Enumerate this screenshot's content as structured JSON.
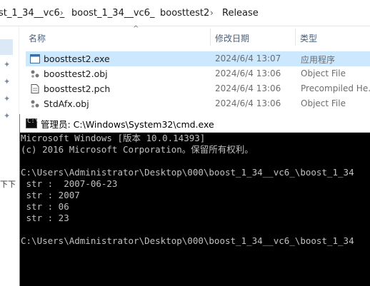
{
  "explorer": {
    "breadcrumb": [
      "st_1_34__vc6_",
      "boost_1_34__vc6_",
      "boosttest2",
      "Release"
    ],
    "columns": {
      "name": "名称",
      "date": "修改日期",
      "type": "类型"
    },
    "files": [
      {
        "name": "boosttest2.exe",
        "date": "2024/6/4 13:07",
        "type": "应用程序",
        "icon": "exe-icon",
        "selected": true
      },
      {
        "name": "boosttest2.obj",
        "date": "2024/6/4 13:06",
        "type": "Object File",
        "icon": "obj-icon"
      },
      {
        "name": "boosttest2.pch",
        "date": "2024/6/4 13:06",
        "type": "Precompiled He...",
        "icon": "pch-icon"
      },
      {
        "name": "StdAfx.obj",
        "date": "2024/6/4 13:06",
        "type": "Object File",
        "icon": "obj-icon"
      }
    ],
    "left_edge_text": "下下"
  },
  "cmd": {
    "title": "管理员: C:\\Windows\\System32\\cmd.exe",
    "lines": [
      "Microsoft Windows [版本 10.0.14393]",
      "(c) 2016 Microsoft Corporation。保留所有权利。",
      "",
      "C:\\Users\\Administrator\\Desktop\\000\\boost_1_34__vc6_\\boost_1_34",
      " str :  2007-06-23",
      " str : 2007",
      " str : 06",
      " str : 23",
      "",
      "C:\\Users\\Administrator\\Desktop\\000\\boost_1_34__vc6_\\boost_1_34"
    ]
  },
  "colors": {
    "selection": "#cce8ff",
    "console_bg": "#000000",
    "console_fg": "#c0c0c0"
  }
}
